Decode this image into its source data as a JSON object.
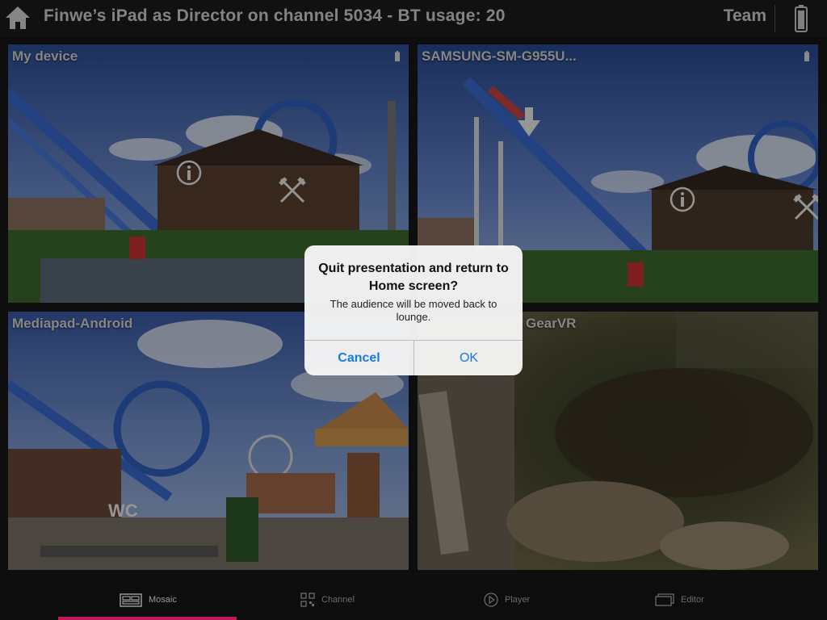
{
  "header": {
    "title": "Finwe’s iPad as Director on channel 5034 - BT usage: 20",
    "team_label": "Team",
    "home_icon": "home-icon",
    "battery_icon": "battery-icon"
  },
  "tiles": [
    {
      "label": "My device",
      "battery_icon": "battery-icon",
      "overlay_icons": [
        "info-icon",
        "restaurant-icon"
      ]
    },
    {
      "label": "SAMSUNG-SM-G955U...",
      "battery_icon": "battery-icon",
      "overlay_icons": [
        "down-arrow-icon",
        "info-icon",
        "restaurant-icon"
      ]
    },
    {
      "label": "Mediapad-Android",
      "overlay_text": "WC"
    },
    {
      "label": "GearVR"
    }
  ],
  "dialog": {
    "title": "Quit presentation and return to Home screen?",
    "message": "The audience will be moved back to lounge.",
    "cancel_label": "Cancel",
    "ok_label": "OK",
    "button_color": "#1a7be0"
  },
  "tabs": [
    {
      "label": "Mosaic",
      "icon": "mosaic-icon",
      "active": true
    },
    {
      "label": "Channel",
      "icon": "qr-code-icon",
      "active": false
    },
    {
      "label": "Player",
      "icon": "play-icon",
      "active": false
    },
    {
      "label": "Editor",
      "icon": "editor-icon",
      "active": false
    }
  ],
  "colors": {
    "active_tab_indicator": "#c2185b",
    "background": "#181818"
  }
}
